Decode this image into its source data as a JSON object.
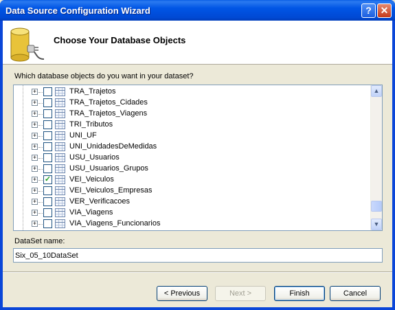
{
  "window": {
    "title": "Data Source Configuration Wizard",
    "help_glyph": "?",
    "close_glyph": "✕"
  },
  "header": {
    "title": "Choose Your Database Objects",
    "icon": "database-plug-icon"
  },
  "question": "Which database objects do you want in your dataset?",
  "tree": {
    "rows": [
      {
        "label": "TRA_Trajetos",
        "checked": false
      },
      {
        "label": "TRA_Trajetos_Cidades",
        "checked": false
      },
      {
        "label": "TRA_Trajetos_Viagens",
        "checked": false
      },
      {
        "label": "TRI_Tributos",
        "checked": false
      },
      {
        "label": "UNI_UF",
        "checked": false
      },
      {
        "label": "UNI_UnidadesDeMedidas",
        "checked": false
      },
      {
        "label": "USU_Usuarios",
        "checked": false
      },
      {
        "label": "USU_Usuarios_Grupos",
        "checked": false
      },
      {
        "label": "VEI_Veiculos",
        "checked": true
      },
      {
        "label": "VEI_Veiculos_Empresas",
        "checked": false
      },
      {
        "label": "VER_Verificacoes",
        "checked": false
      },
      {
        "label": "VIA_Viagens",
        "checked": false
      },
      {
        "label": "VIA_Viagens_Funcionarios",
        "checked": false
      }
    ],
    "expander_glyph": "+",
    "check_glyph": "✓",
    "scroll_up_glyph": "▲",
    "scroll_down_glyph": "▼"
  },
  "dataset": {
    "label": "DataSet name:",
    "value": "Six_05_10DataSet"
  },
  "buttons": {
    "previous": "< Previous",
    "next": "Next >",
    "finish": "Finish",
    "cancel": "Cancel"
  }
}
